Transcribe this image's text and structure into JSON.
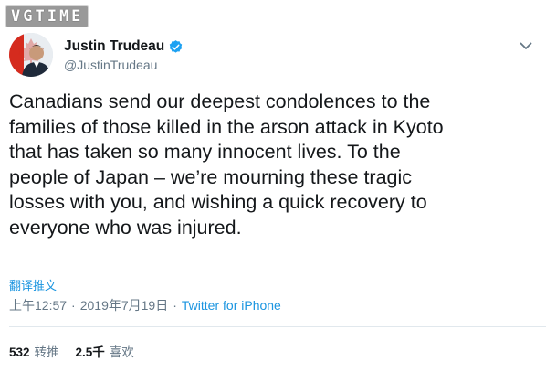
{
  "watermark": {
    "text": "VGTIME"
  },
  "author": {
    "display_name": "Justin Trudeau",
    "handle": "@JustinTrudeau",
    "verified": true
  },
  "tweet": {
    "lines": [
      "Canadians send our deepest condolences to the",
      "families of those killed in the arson attack in Kyoto",
      "that has taken so many innocent lives. To the",
      "people of Japan – we’re mourning these tragic",
      "losses with you, and wishing a quick recovery to",
      "everyone who was injured."
    ],
    "translate_label": "翻译推文",
    "time": "上午12:57",
    "separator": "·",
    "date": "2019年7月19日",
    "source": "Twitter for iPhone"
  },
  "stats": {
    "retweets_count": "532",
    "retweets_label": "转推",
    "likes_count": "2.5千",
    "likes_label": "喜欢"
  },
  "colors": {
    "link": "#1b95e0",
    "secondary_text": "#657786",
    "primary_text": "#14171a",
    "verified_badge": "#1da1f2"
  },
  "icons": {
    "verified": "verified-badge-icon",
    "caret": "chevron-down-icon"
  }
}
